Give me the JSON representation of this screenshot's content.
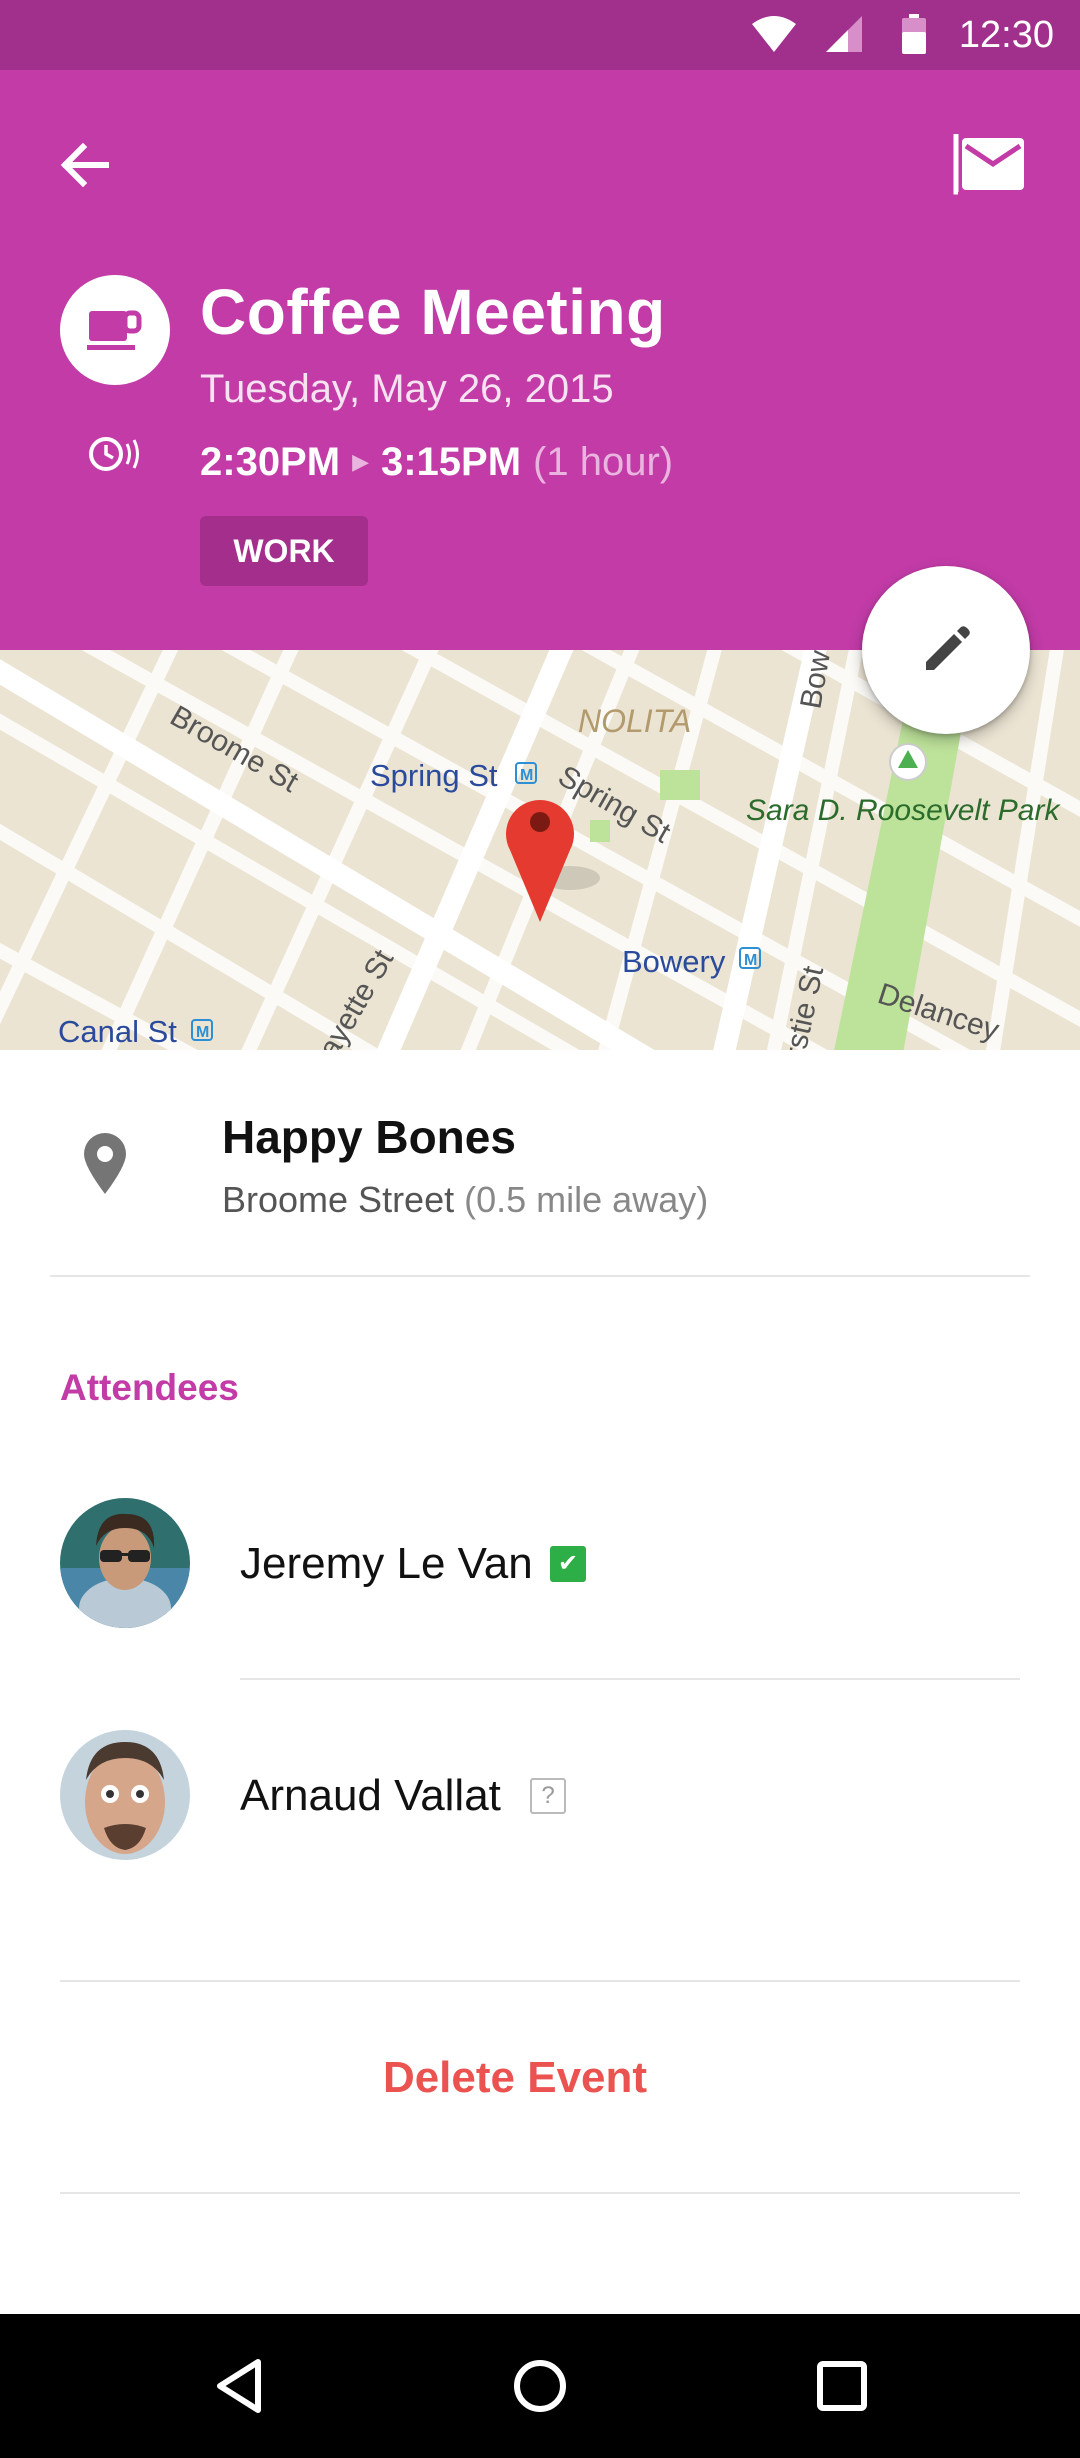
{
  "status_bar": {
    "time": "12:30"
  },
  "colors": {
    "header": "#c23ba7",
    "status_bar": "#a1308d",
    "tag_bg": "#a32e8c",
    "accent": "#c23ba7",
    "delete": "#ea5350",
    "accepted": "#2eae47"
  },
  "event": {
    "title": "Coffee Meeting",
    "date": "Tuesday, May 26, 2015",
    "start": "2:30PM",
    "end": "3:15PM",
    "duration": "(1 hour)",
    "tag": "WORK",
    "category_icon": "coffee-cup-icon"
  },
  "map": {
    "labels": {
      "broome": "Broome St",
      "spring_station": "Spring St",
      "spring_street": "Spring St",
      "nolita": "NOLITA",
      "bowery_street": "Bowe",
      "park": "Sara D. Roosevelt Park",
      "bowery_station": "Bowery",
      "lafayette": "ayette St",
      "chrystie": "rstie St",
      "delancey": "Delancey",
      "canal": "Canal St"
    }
  },
  "location": {
    "name": "Happy Bones",
    "street": "Broome Street",
    "distance": "(0.5 mile away)"
  },
  "attendees_section": {
    "title": "Attendees",
    "list": [
      {
        "name": "Jeremy Le Van",
        "status": "accepted",
        "status_icon": "checkmark-icon"
      },
      {
        "name": "Arnaud Vallat",
        "status": "unknown",
        "status_icon": "?"
      }
    ]
  },
  "actions": {
    "delete": "Delete Event"
  }
}
